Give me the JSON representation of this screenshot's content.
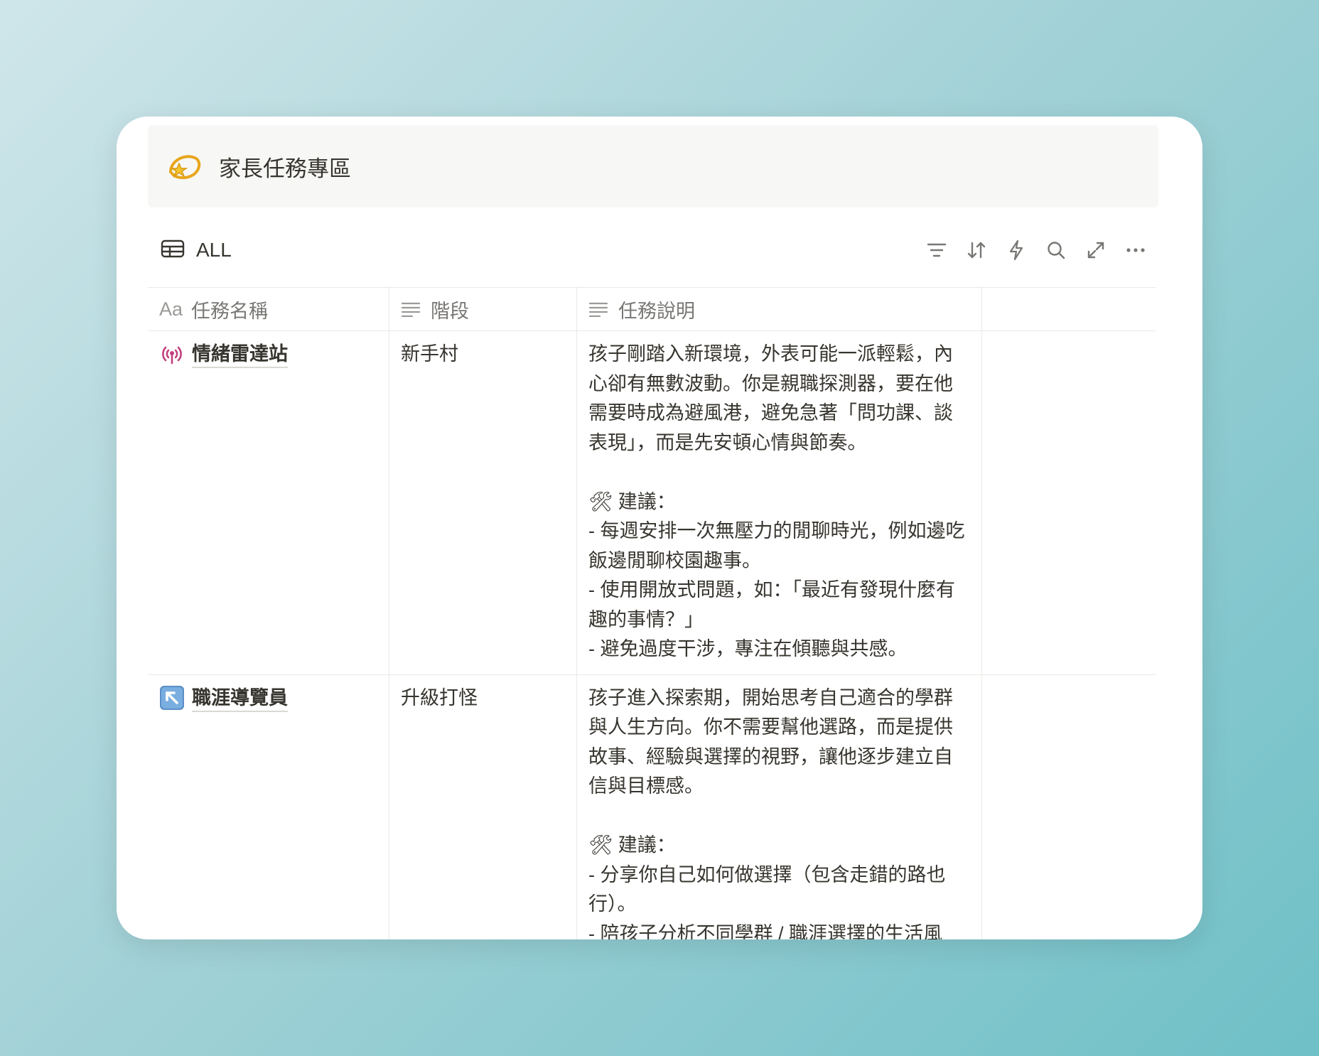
{
  "callout": {
    "icon": "dizzy-star-icon",
    "title": "家長任務專區"
  },
  "view": {
    "tab_icon": "table-icon",
    "tab_label": "ALL",
    "tools": [
      "filter-icon",
      "sort-icon",
      "automation-bolt-icon",
      "search-icon",
      "expand-icon",
      "more-icon"
    ]
  },
  "table": {
    "headers": {
      "name_prefix": "Aa",
      "name": "任務名稱",
      "stage": "階段",
      "desc": "任務說明"
    },
    "rows": [
      {
        "icon": "antenna-signal-icon",
        "name": "情緒雷達站",
        "stage": "新手村",
        "desc": "孩子剛踏入新環境，外表可能一派輕鬆，內心卻有無數波動。你是親職探測器，要在他需要時成為避風港，避免急著「問功課、談表現」，而是先安頓心情與節奏。\n\n🛠 建議：\n- 每週安排一次無壓力的閒聊時光，例如邊吃飯邊閒聊校園趣事。\n- 使用開放式問題，如：「最近有發現什麼有趣的事情？」\n- 避免過度干涉，專注在傾聽與共感。"
      },
      {
        "icon": "up-left-arrow-icon",
        "name": "職涯導覽員",
        "stage": "升級打怪",
        "desc": "孩子進入探索期，開始思考自己適合的學群與人生方向。你不需要幫他選路，而是提供故事、經驗與選擇的視野，讓他逐步建立自信與目標感。\n\n🛠 建議：\n- 分享你自己如何做選擇（包含走錯的路也行）。\n- 陪孩子分析不同學群 / 職涯選擇的生活風"
      }
    ]
  }
}
